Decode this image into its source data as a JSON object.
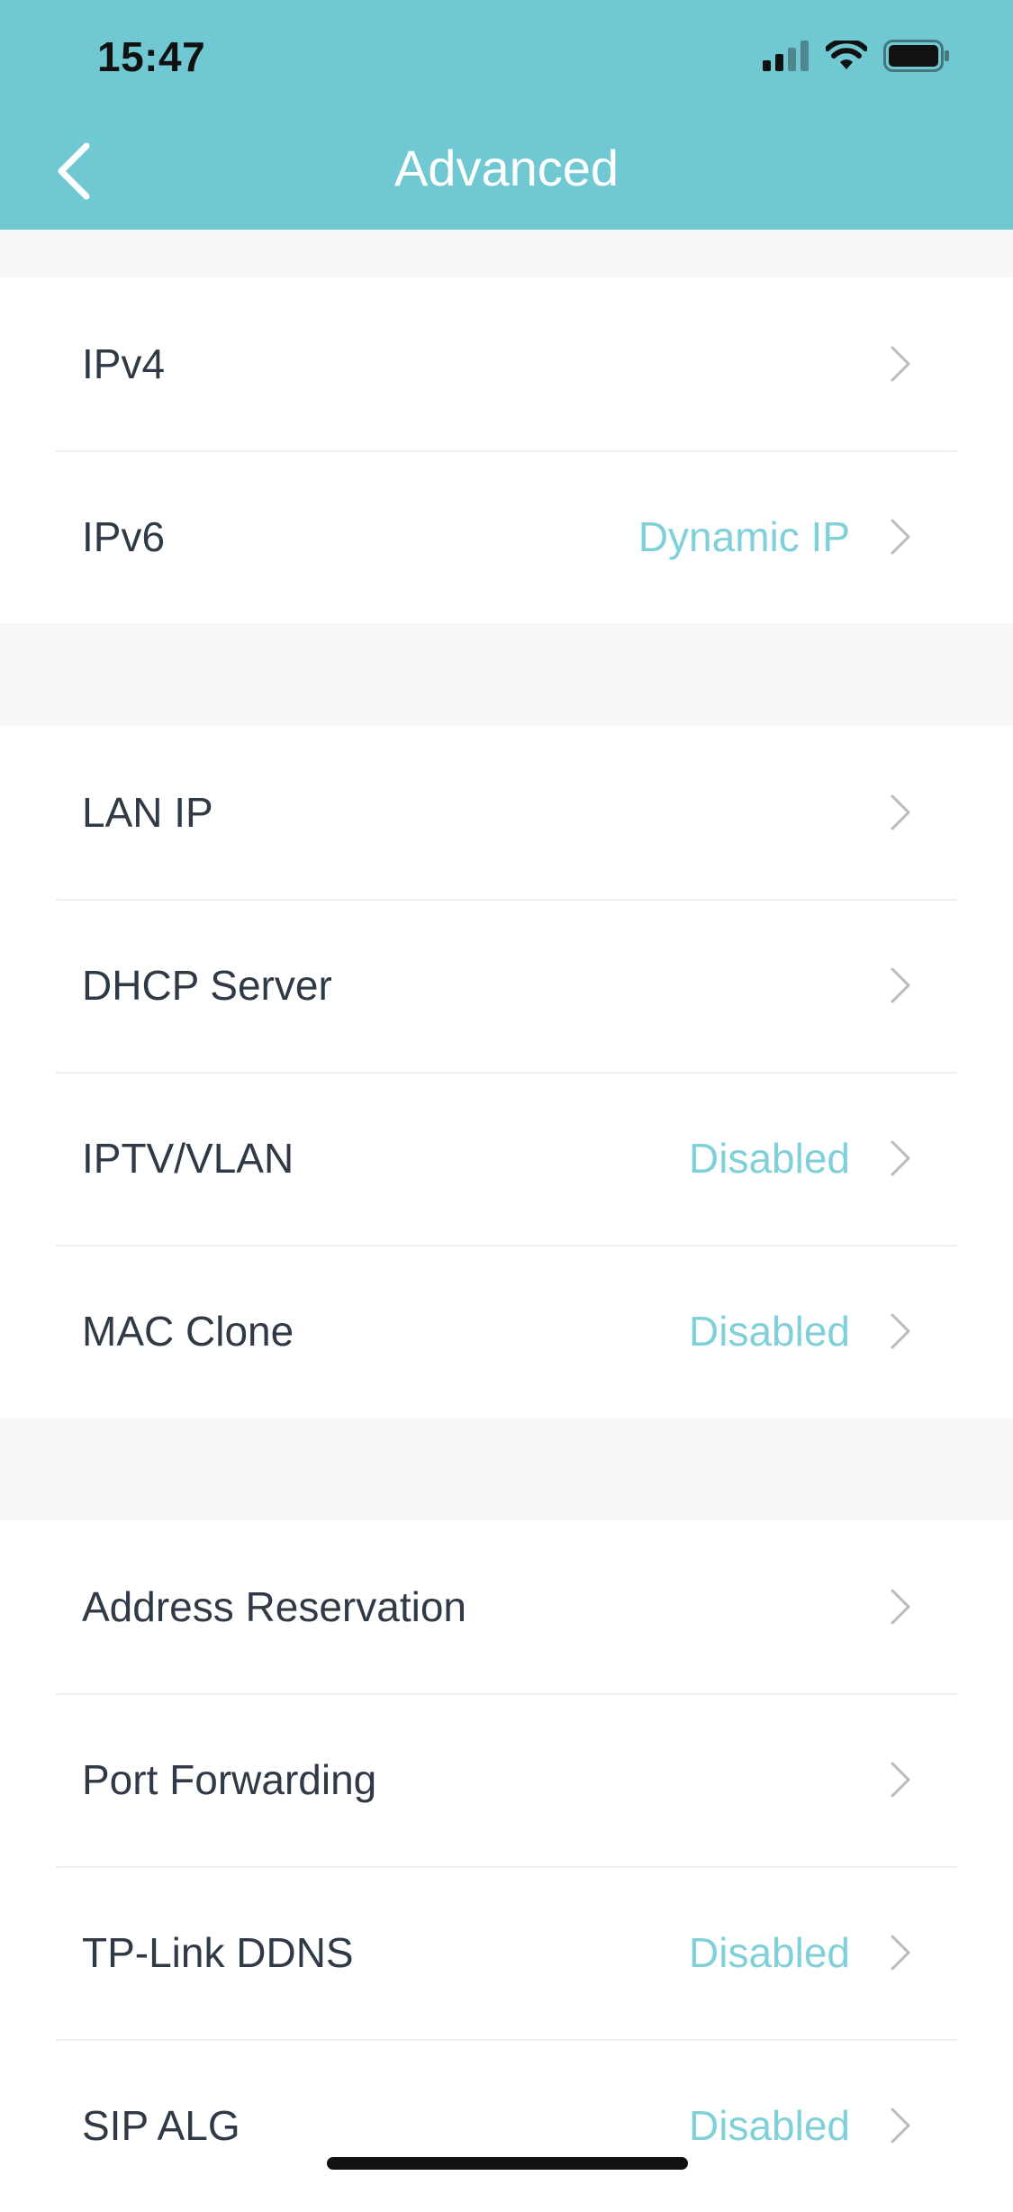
{
  "status_bar": {
    "time": "15:47"
  },
  "header": {
    "title": "Advanced",
    "background_color": "#6fc8d2"
  },
  "groups": [
    {
      "items": [
        {
          "label": "IPv4",
          "value": ""
        },
        {
          "label": "IPv6",
          "value": "Dynamic IP"
        }
      ]
    },
    {
      "items": [
        {
          "label": "LAN IP",
          "value": ""
        },
        {
          "label": "DHCP Server",
          "value": ""
        },
        {
          "label": "IPTV/VLAN",
          "value": "Disabled"
        },
        {
          "label": "MAC Clone",
          "value": "Disabled"
        }
      ]
    },
    {
      "items": [
        {
          "label": "Address Reservation",
          "value": ""
        },
        {
          "label": "Port Forwarding",
          "value": ""
        },
        {
          "label": "TP-Link DDNS",
          "value": "Disabled"
        },
        {
          "label": "SIP ALG",
          "value": "Disabled"
        }
      ]
    }
  ],
  "colors": {
    "accent": "#7fd0d9",
    "label_text": "#2f3a46",
    "page_background": "#f8f8f9"
  },
  "icons": {
    "back": "chevron-left-icon",
    "row": "chevron-right-icon",
    "signal": "cellular-signal-icon",
    "wifi": "wifi-icon",
    "battery": "battery-icon"
  }
}
